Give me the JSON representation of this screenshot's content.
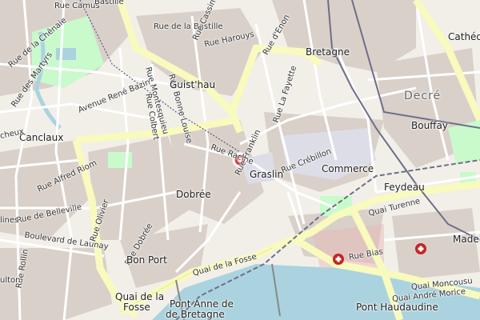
{
  "colors": {
    "land": "#f2efe9",
    "built": "#d9d0c9",
    "primary_road": "#f8fabe",
    "minor_road": "#ffffff",
    "water": "#aad3df",
    "park": "#c8facc",
    "pedestrian": "#dddde8",
    "rail": "#808080",
    "hospital": "#e8b6b6",
    "marker": "#e04040"
  },
  "labels": {
    "rue_camus": "Rue Camus",
    "bastille_top": "Bastille",
    "rue_de_la_bastille": "Rue de la Bastille",
    "rue_harouys": "Rue Harouys",
    "rue_cassini": "Rue Cassini",
    "rue_d_enon": "Rue d'Enon",
    "rue_de_la_cheneau": "Rue de la Chênaie",
    "rue_des_martyrs": "Rue des Martyrs",
    "avenue_rene_bazin": "Avenue René Bazin",
    "rue_montesquieu": "Rue Montesquieu",
    "rue_bonne_louise": "Rue Bonne Louise",
    "rue_colbert": "Rue Colbert",
    "guisthau": "Guist'hau",
    "bretagne": "Bretagne",
    "rue_la_fayette": "Rue La Fayette",
    "decre": "Decré",
    "cathedrale": "Cathédr",
    "bouffay": "Bouffay",
    "canclaux": "Canclaux",
    "boulevard_cheuze": "cheux",
    "rue_alfred_riom": "Rue Alfred Riom",
    "rue_racine": "Rue Racine",
    "rue_franklin": "Rue Franklin",
    "graslin": "Graslin",
    "rue_crebillon": "Rue Crébillon",
    "commerce": "Commerce",
    "feydeau": "Feydeau",
    "quai_turenne": "Quai Turenne",
    "dobree": "Dobrée",
    "rue_de_belleville": "Rue de Belleville",
    "rue_olivier": "Rue Olivier",
    "boulevard_de_launay": "Boulevard de Launay",
    "rue_rollin": "Rue Rollin",
    "rue_dobree": "Rue Dobrée",
    "bon_port": "Bon Port",
    "quai_de_la_fosse_road": "Quai de la Fosse",
    "quai_de_la_fosse": "Quai de la",
    "quai_de_la_fosse_2": "Fosse",
    "pont_anne_1": "Pont Anne de",
    "pont_anne_2": "de Bretagne",
    "rue_bias": "Rue Bias",
    "quai_moncousu": "Quai Moncousu",
    "quai_andre_morice": "Quai André Morice",
    "pont_haudaudine": "Pont Haudaudine",
    "madeleine": "Madele",
    "linieres": "lines",
    "rue_mills": "Rue",
    "rue_sulton": "ulton"
  }
}
